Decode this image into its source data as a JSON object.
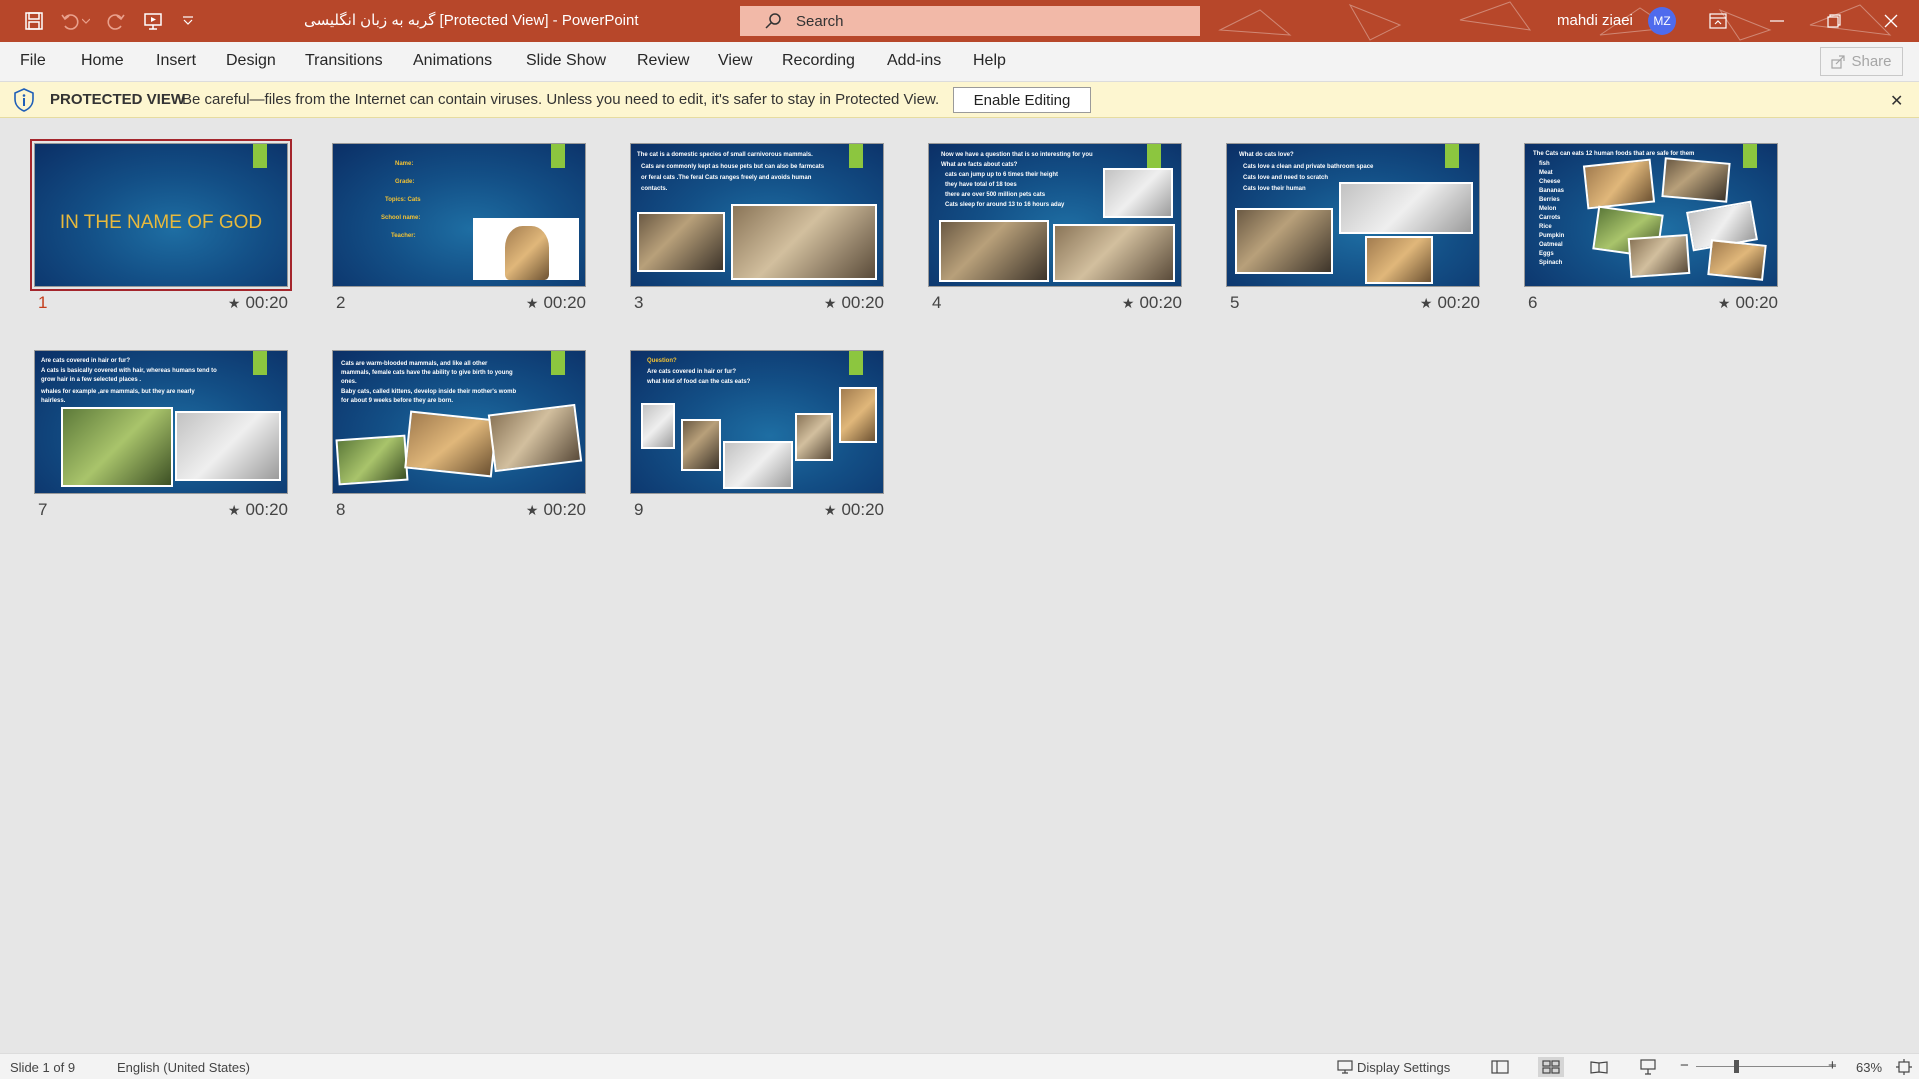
{
  "titlebar": {
    "title": "گربه به زبان انگلیسی [Protected View]  -  PowerPoint",
    "search_placeholder": "Search",
    "user_name": "mahdi ziaei",
    "user_initials": "MZ"
  },
  "menu": {
    "items": [
      "File",
      "Home",
      "Insert",
      "Design",
      "Transitions",
      "Animations",
      "Slide Show",
      "Review",
      "View",
      "Recording",
      "Add-ins",
      "Help"
    ],
    "share_label": "Share"
  },
  "protected_view": {
    "title": "PROTECTED VIEW",
    "message": "Be careful—files from the Internet can contain viruses. Unless you need to edit, it's safer to stay in Protected View.",
    "enable_label": "Enable Editing",
    "close_glyph": "✕"
  },
  "slides": [
    {
      "number": "1",
      "time": "00:20",
      "title": "IN THE NAME OF GOD"
    },
    {
      "number": "2",
      "time": "00:20",
      "lines": [
        "Name:",
        "Grade:",
        "Topics: Cats",
        "School name:",
        "Teacher:"
      ]
    },
    {
      "number": "3",
      "time": "00:20",
      "lines": [
        "The cat is a domestic species of small carnivorous mammals.",
        "Cats are commonly kept as house pets but can also be farmcats",
        "or feral cats .The feral Cats ranges freely and avoids human",
        "contacts."
      ]
    },
    {
      "number": "4",
      "time": "00:20",
      "lines": [
        "Now we have a question that is so interesting for you",
        "What are facts about cats?",
        "cats can jump up to 6 times their height",
        "they have total of 18 toes",
        "there are over 500 million pets cats",
        "Cats sleep for around 13 to 16 hours aday"
      ]
    },
    {
      "number": "5",
      "time": "00:20",
      "lines": [
        "What do cats love?",
        "Cats love a clean and private bathroom space",
        "Cats love and need to scratch",
        "Cats love their human"
      ]
    },
    {
      "number": "6",
      "time": "00:20",
      "lines": [
        "The Cats can eats 12 human foods that are safe for them",
        "fish",
        "Meat",
        "Cheese",
        "Bananas",
        "Berries",
        "Melon",
        "Carrots",
        "Rice",
        "Pumpkin",
        "Oatmeal",
        "Eggs",
        "Spinach"
      ]
    },
    {
      "number": "7",
      "time": "00:20",
      "lines": [
        "Are cats covered in hair or fur?",
        "A cats is basically covered with hair, whereas humans tend to",
        "grow hair in a few selected places .",
        "whales for example ,are mammals, but they are nearly",
        "hairless."
      ]
    },
    {
      "number": "8",
      "time": "00:20",
      "lines": [
        "Cats are warm-blooded mammals, and like all other",
        "mammals, female cats have the ability to give birth to young",
        "ones.",
        "Baby cats, called kittens, develop inside their mother's womb",
        "for about 9 weeks before they are born."
      ]
    },
    {
      "number": "9",
      "time": "00:20",
      "lines": [
        "Question?",
        "Are cats covered in hair or fur?",
        "what kind of food can the cats eats?"
      ]
    }
  ],
  "statusbar": {
    "slide_info": "Slide 1 of 9",
    "language": "English (United States)",
    "display_settings": "Display Settings",
    "zoom_minus": "−",
    "zoom_plus": "+",
    "zoom_level": "63%"
  },
  "colors": {
    "accent": "#b7472a",
    "selected_outline": "#a4262c",
    "slide_accent": "#8cc63f",
    "highlight_text": "#f3c234"
  }
}
